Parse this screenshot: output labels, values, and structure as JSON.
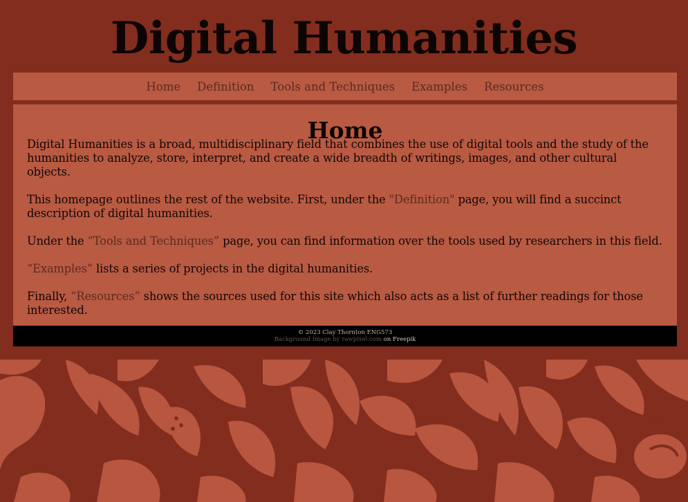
{
  "site": {
    "title": "Digital Humanities"
  },
  "nav": {
    "items": [
      {
        "label": "Home"
      },
      {
        "label": "Definition"
      },
      {
        "label": "Tools and Techniques"
      },
      {
        "label": "Examples"
      },
      {
        "label": "Resources"
      }
    ]
  },
  "main": {
    "heading": "Home",
    "p1": "Digital Humanities is a broad, multidisciplinary field that combines the use of digital tools and the study of the humanities to analyze, store, interpret, and create a wide breadth of writings, images, and other cultural objects.",
    "p2_before": "This homepage outlines the rest of the website. First, under the ",
    "p2_link": "\"Definition\"",
    "p2_after": " page, you will find a succinct description of digital humanities.",
    "p3_before": "Under the ",
    "p3_link": "“Tools and Techniques”",
    "p3_after": " page, you can find information over the tools used by researchers in this field.",
    "p4_link": "“Examples”",
    "p4_after": " lists a series of projects in the digital humanities.",
    "p5_before": "Finally, ",
    "p5_link": "“Resources”",
    "p5_after": " shows the sources used for this site which also acts as a list of further readings for those interested."
  },
  "footer": {
    "copyright": "© 2023 Clay Thornton ENG573",
    "credit_prefix": "Background Image by rawpixel.com",
    "credit_suffix": " on Freepik"
  },
  "colors": {
    "background": "#832d1f",
    "panel": "#b95a43",
    "link": "#5b2a20",
    "footer": "#000000",
    "pattern_leaf": "#b85640"
  }
}
